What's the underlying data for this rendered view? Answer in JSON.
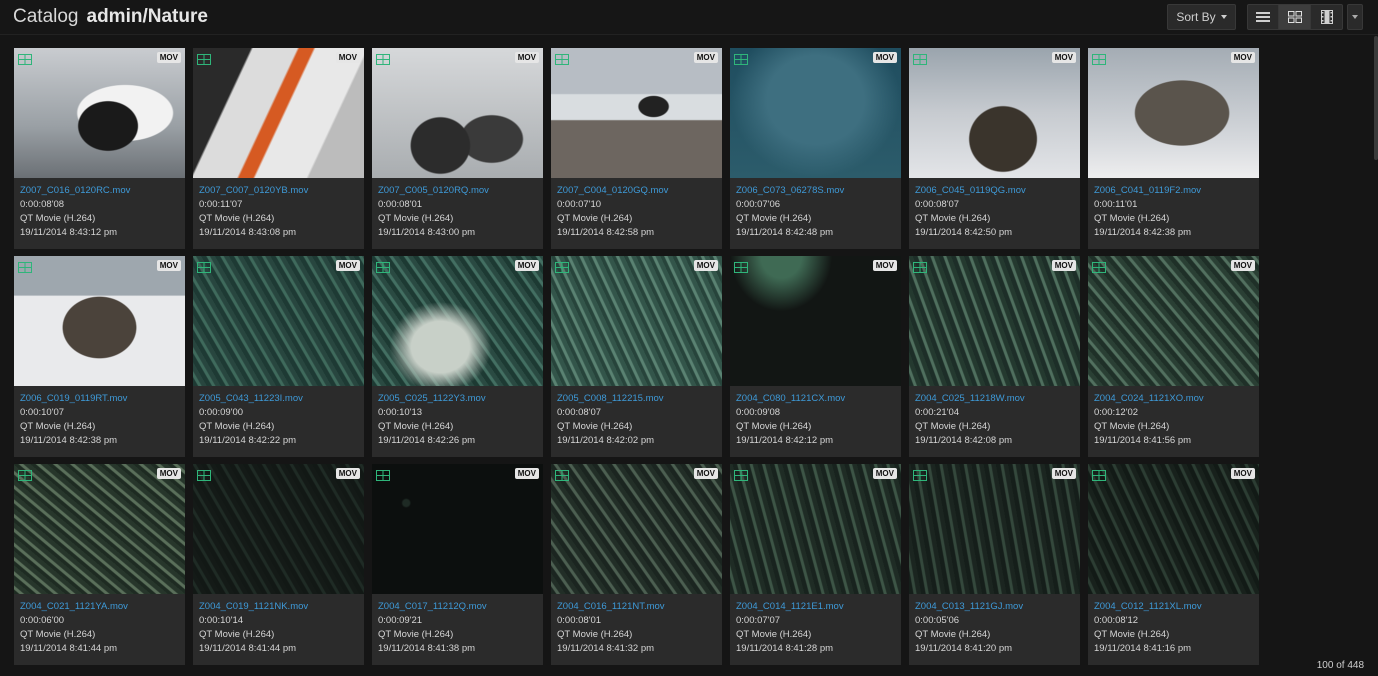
{
  "header": {
    "title": "Catalog",
    "breadcrumb": "admin/Nature",
    "sort_label": "Sort By",
    "footer_count": "100 of 448"
  },
  "icons": {
    "view_list": "list-view-icon",
    "view_grid": "grid-view-icon",
    "view_filmstrip": "filmstrip-view-icon",
    "thumb_type": "film-icon"
  },
  "colors": {
    "background": "#151515",
    "card": "#2b2b2b",
    "filename": "#3e9ad8",
    "film_icon": "#2fb57a"
  },
  "assets": [
    {
      "name": "Z007_C016_0120RC.mov",
      "duration": "0:00:08'08",
      "type": "QT Movie (H.264)",
      "date": "19/11/2014 8:43:12 pm",
      "badge": "MOV",
      "look": "t-peng1"
    },
    {
      "name": "Z007_C007_0120YB.mov",
      "duration": "0:00:11'07",
      "type": "QT Movie (H.264)",
      "date": "19/11/2014 8:43:08 pm",
      "badge": "MOV",
      "look": "t-peng2"
    },
    {
      "name": "Z007_C005_0120RQ.mov",
      "duration": "0:00:08'01",
      "type": "QT Movie (H.264)",
      "date": "19/11/2014 8:43:00 pm",
      "badge": "MOV",
      "look": "t-peng3"
    },
    {
      "name": "Z007_C004_0120GQ.mov",
      "duration": "0:00:07'10",
      "type": "QT Movie (H.264)",
      "date": "19/11/2014 8:42:58 pm",
      "badge": "MOV",
      "look": "t-peng4"
    },
    {
      "name": "Z006_C073_06278S.mov",
      "duration": "0:00:07'06",
      "type": "QT Movie (H.264)",
      "date": "19/11/2014 8:42:48 pm",
      "badge": "MOV",
      "look": "t-sea1"
    },
    {
      "name": "Z006_C045_0119QG.mov",
      "duration": "0:00:08'07",
      "type": "QT Movie (H.264)",
      "date": "19/11/2014 8:42:50 pm",
      "badge": "MOV",
      "look": "t-seal1"
    },
    {
      "name": "Z006_C041_0119F2.mov",
      "duration": "0:00:11'01",
      "type": "QT Movie (H.264)",
      "date": "19/11/2014 8:42:38 pm",
      "badge": "MOV",
      "look": "t-seal2"
    },
    {
      "name": "Z006_C019_0119RT.mov",
      "duration": "0:00:10'07",
      "type": "QT Movie (H.264)",
      "date": "19/11/2014 8:42:38 pm",
      "badge": "MOV",
      "look": "t-seal3"
    },
    {
      "name": "Z005_C043_11223I.mov",
      "duration": "0:00:09'00",
      "type": "QT Movie (H.264)",
      "date": "19/11/2014 8:42:22 pm",
      "badge": "MOV",
      "look": "t-krill"
    },
    {
      "name": "Z005_C025_1122Y3.mov",
      "duration": "0:00:10'13",
      "type": "QT Movie (H.264)",
      "date": "19/11/2014 8:42:26 pm",
      "badge": "MOV",
      "look": "t-krill2"
    },
    {
      "name": "Z005_C008_112215.mov",
      "duration": "0:00:08'07",
      "type": "QT Movie (H.264)",
      "date": "19/11/2014 8:42:02 pm",
      "badge": "MOV",
      "look": "t-krill3"
    },
    {
      "name": "Z004_C080_1121CX.mov",
      "duration": "0:00:09'08",
      "type": "QT Movie (H.264)",
      "date": "19/11/2014 8:42:12 pm",
      "badge": "MOV",
      "look": "t-dark"
    },
    {
      "name": "Z004_C025_11218W.mov",
      "duration": "0:00:21'04",
      "type": "QT Movie (H.264)",
      "date": "19/11/2014 8:42:08 pm",
      "badge": "MOV",
      "look": "t-krill4"
    },
    {
      "name": "Z004_C024_1121XO.mov",
      "duration": "0:00:12'02",
      "type": "QT Movie (H.264)",
      "date": "19/11/2014 8:41:56 pm",
      "badge": "MOV",
      "look": "t-krill5"
    },
    {
      "name": "Z004_C021_1121YA.mov",
      "duration": "0:00:06'00",
      "type": "QT Movie (H.264)",
      "date": "19/11/2014 8:41:44 pm",
      "badge": "MOV",
      "look": "t-krill6"
    },
    {
      "name": "Z004_C019_1121NK.mov",
      "duration": "0:00:10'14",
      "type": "QT Movie (H.264)",
      "date": "19/11/2014 8:41:44 pm",
      "badge": "MOV",
      "look": "t-darker"
    },
    {
      "name": "Z004_C017_11212Q.mov",
      "duration": "0:00:09'21",
      "type": "QT Movie (H.264)",
      "date": "19/11/2014 8:41:38 pm",
      "badge": "MOV",
      "look": "t-black"
    },
    {
      "name": "Z004_C016_1121NT.mov",
      "duration": "0:00:08'01",
      "type": "QT Movie (H.264)",
      "date": "19/11/2014 8:41:32 pm",
      "badge": "MOV",
      "look": "t-krill7"
    },
    {
      "name": "Z004_C014_1121E1.mov",
      "duration": "0:00:07'07",
      "type": "QT Movie (H.264)",
      "date": "19/11/2014 8:41:28 pm",
      "badge": "MOV",
      "look": "t-krill8"
    },
    {
      "name": "Z004_C013_1121GJ.mov",
      "duration": "0:00:05'06",
      "type": "QT Movie (H.264)",
      "date": "19/11/2014 8:41:20 pm",
      "badge": "MOV",
      "look": "t-krill9"
    },
    {
      "name": "Z004_C012_1121XL.mov",
      "duration": "0:00:08'12",
      "type": "QT Movie (H.264)",
      "date": "19/11/2014 8:41:16 pm",
      "badge": "MOV",
      "look": "t-krill10"
    }
  ]
}
